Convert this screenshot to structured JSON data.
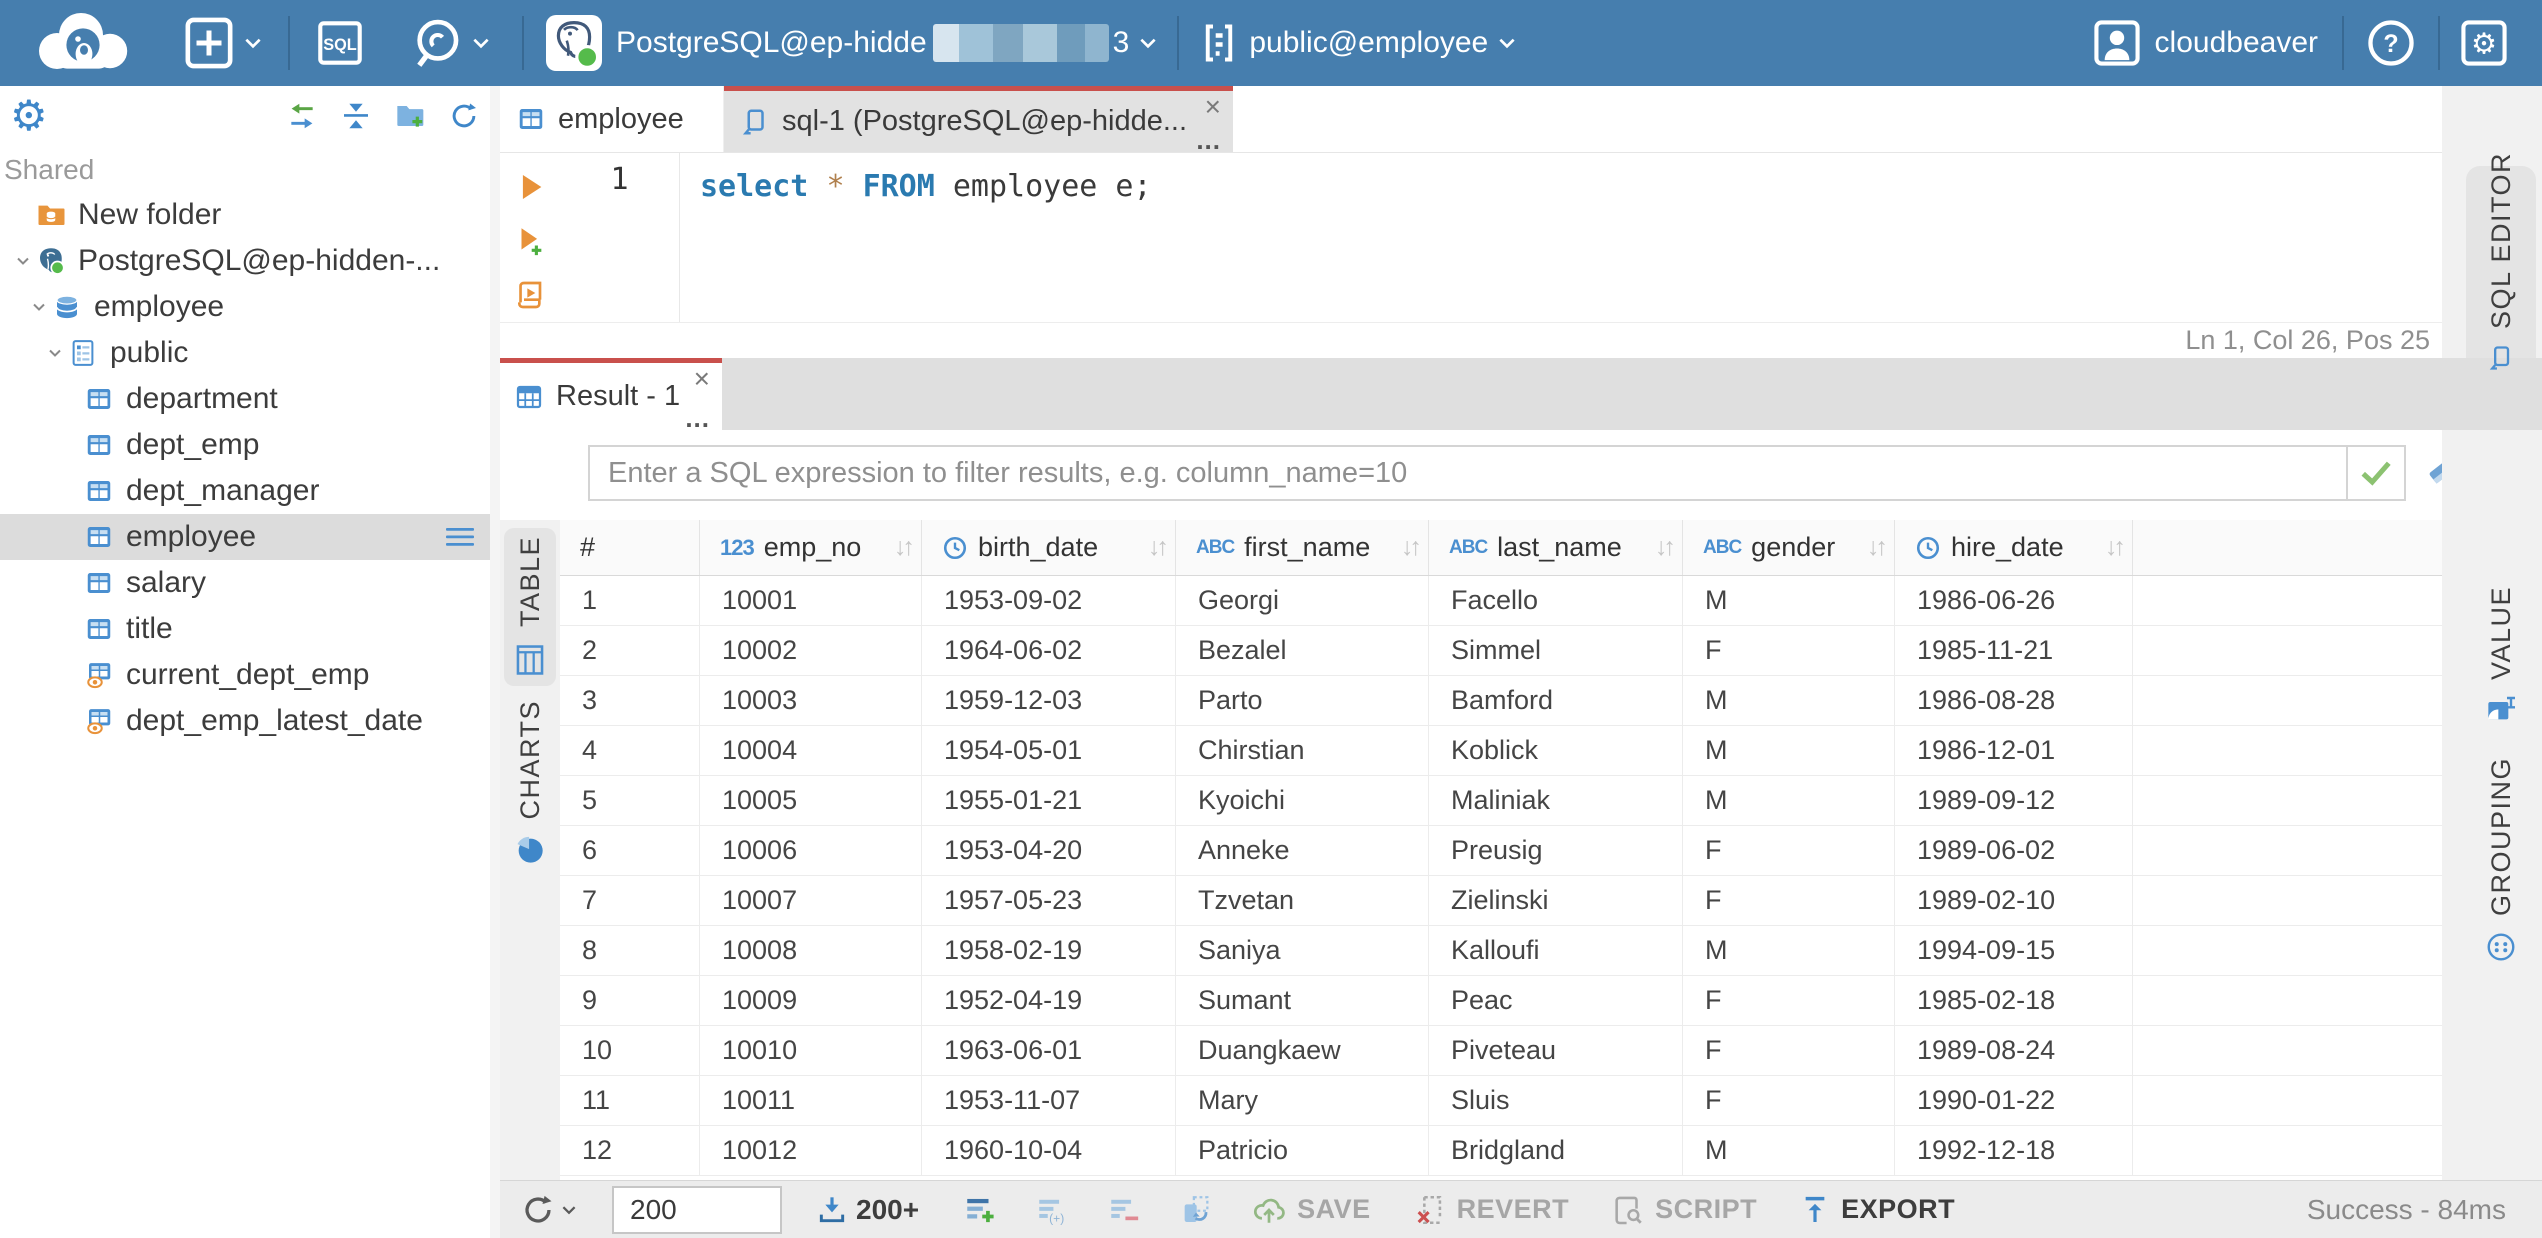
{
  "ui": {
    "close": "×",
    "ellipsis": "...",
    "sort_arrows": "↓↑",
    "type_badges": {
      "number": "123",
      "string": "ABC"
    }
  },
  "topbar": {
    "sql_badge": "SQL",
    "connection": {
      "label": "PostgreSQL@ep-hidde",
      "suffix": "3"
    },
    "schema": "public@employee",
    "user_name": "cloudbeaver",
    "help_glyph": "?"
  },
  "sidebar": {
    "section_label": "Shared",
    "tree": [
      {
        "label": "New folder",
        "icon": "folder-db",
        "level": 0,
        "chevron": false
      },
      {
        "label": "PostgreSQL@ep-hidden-...",
        "icon": "postgres",
        "level": 0,
        "chevron": true
      },
      {
        "label": "employee",
        "icon": "database",
        "level": 1,
        "chevron": true
      },
      {
        "label": "public",
        "icon": "schema",
        "level": 2,
        "chevron": true
      },
      {
        "label": "department",
        "icon": "table",
        "level": 3,
        "chevron": false
      },
      {
        "label": "dept_emp",
        "icon": "table",
        "level": 3,
        "chevron": false
      },
      {
        "label": "dept_manager",
        "icon": "table",
        "level": 3,
        "chevron": false
      },
      {
        "label": "employee",
        "icon": "table",
        "level": 3,
        "chevron": false,
        "selected": true
      },
      {
        "label": "salary",
        "icon": "table",
        "level": 3,
        "chevron": false
      },
      {
        "label": "title",
        "icon": "table",
        "level": 3,
        "chevron": false
      },
      {
        "label": "current_dept_emp",
        "icon": "view",
        "level": 3,
        "chevron": false
      },
      {
        "label": "dept_emp_latest_date",
        "icon": "view",
        "level": 3,
        "chevron": false
      }
    ]
  },
  "editor": {
    "tabs": {
      "table_tab": "employee",
      "sql_tab": "sql-1 (PostgreSQL@ep-hidde..."
    },
    "line_number": "1",
    "code_tokens": [
      {
        "text": "select",
        "type": "kw"
      },
      {
        "text": " ",
        "type": "plain"
      },
      {
        "text": "*",
        "type": "star"
      },
      {
        "text": " ",
        "type": "plain"
      },
      {
        "text": "FROM",
        "type": "kw"
      },
      {
        "text": " employee e;",
        "type": "plain"
      }
    ],
    "status": "Ln 1, Col 26, Pos 25"
  },
  "results": {
    "tab_label": "Result - 1",
    "filter_placeholder": "Enter a SQL expression to filter results, e.g. column_name=10",
    "view_tabs": {
      "table": "TABLE",
      "charts": "CHARTS"
    },
    "side_tabs": {
      "sql_editor": "SQL EDITOR",
      "value": "VALUE",
      "grouping": "GROUPING"
    },
    "grid": {
      "columns": [
        {
          "label": "#",
          "type": "none"
        },
        {
          "label": "emp_no",
          "type": "number"
        },
        {
          "label": "birth_date",
          "type": "datetime"
        },
        {
          "label": "first_name",
          "type": "string"
        },
        {
          "label": "last_name",
          "type": "string"
        },
        {
          "label": "gender",
          "type": "string"
        },
        {
          "label": "hire_date",
          "type": "datetime"
        }
      ],
      "rows": [
        [
          "1",
          "10001",
          "1953-09-02",
          "Georgi",
          "Facello",
          "M",
          "1986-06-26"
        ],
        [
          "2",
          "10002",
          "1964-06-02",
          "Bezalel",
          "Simmel",
          "F",
          "1985-11-21"
        ],
        [
          "3",
          "10003",
          "1959-12-03",
          "Parto",
          "Bamford",
          "M",
          "1986-08-28"
        ],
        [
          "4",
          "10004",
          "1954-05-01",
          "Chirstian",
          "Koblick",
          "M",
          "1986-12-01"
        ],
        [
          "5",
          "10005",
          "1955-01-21",
          "Kyoichi",
          "Maliniak",
          "M",
          "1989-09-12"
        ],
        [
          "6",
          "10006",
          "1953-04-20",
          "Anneke",
          "Preusig",
          "F",
          "1989-06-02"
        ],
        [
          "7",
          "10007",
          "1957-05-23",
          "Tzvetan",
          "Zielinski",
          "F",
          "1989-02-10"
        ],
        [
          "8",
          "10008",
          "1958-02-19",
          "Saniya",
          "Kalloufi",
          "M",
          "1994-09-15"
        ],
        [
          "9",
          "10009",
          "1952-04-19",
          "Sumant",
          "Peac",
          "F",
          "1985-02-18"
        ],
        [
          "10",
          "10010",
          "1963-06-01",
          "Duangkaew",
          "Piveteau",
          "F",
          "1989-08-24"
        ],
        [
          "11",
          "10011",
          "1953-11-07",
          "Mary",
          "Sluis",
          "F",
          "1990-01-22"
        ],
        [
          "12",
          "10012",
          "1960-10-04",
          "Patricio",
          "Bridgland",
          "M",
          "1992-12-18"
        ]
      ]
    }
  },
  "toolbar": {
    "row_limit": "200",
    "fetch_label": "200+",
    "save_label": "SAVE",
    "revert_label": "REVERT",
    "script_label": "SCRIPT",
    "export_label": "EXPORT",
    "status": "Success - 84ms"
  },
  "colors": {
    "topbar": "#467eae",
    "accent_red": "#c9504c",
    "icon_blue": "#4a8fd0",
    "orange": "#e8923a",
    "green": "#55bb4b",
    "selected_row": "#dcdcdc"
  }
}
